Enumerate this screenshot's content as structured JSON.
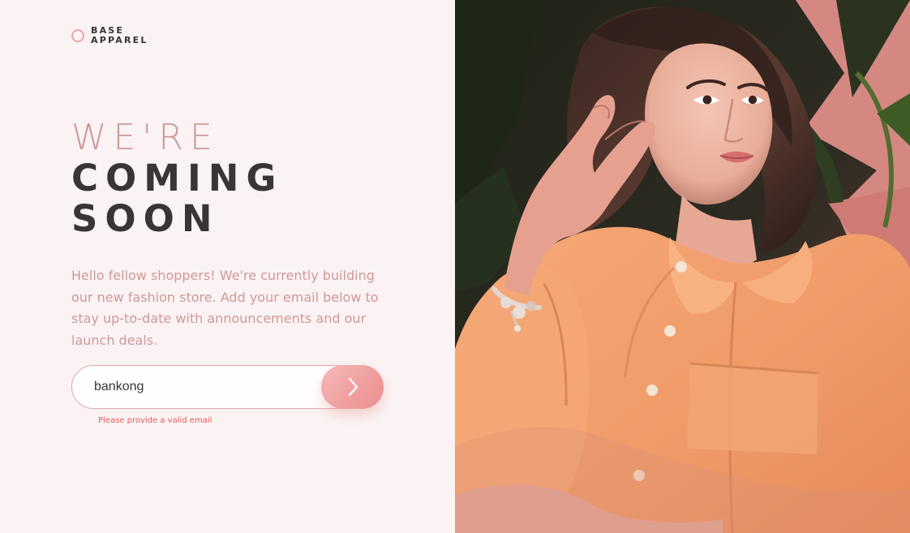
{
  "brand": {
    "line1": "BASE",
    "line2": "APPAREL"
  },
  "headline": {
    "light": "WE'RE",
    "bold_line1": "COMING",
    "bold_line2": "SOON"
  },
  "description": "Hello fellow shoppers! We're currently building our new fashion store. Add your email below to stay up-to-date with announcements and our launch deals.",
  "form": {
    "email_value": "bankong",
    "error_message": "Please provide a valid email"
  },
  "icons": {
    "logo": "brand-ring-icon",
    "submit": "chevron-right-icon"
  },
  "colors": {
    "background": "#fbf3f3",
    "accent": "#e9a7a7",
    "headline_light": "#cc9a9a",
    "headline_dark": "#3b3434",
    "error": "#e55b5b",
    "photo_shirt": "#f2a26e"
  }
}
